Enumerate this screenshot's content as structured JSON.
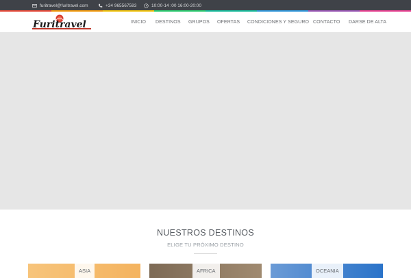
{
  "topbar": {
    "email": "furitravel@furitravel.com",
    "phone": "+34 965567583",
    "hours": "10:00-14 :00 16:00-20:00",
    "icons": {
      "email": "envelope-icon",
      "phone": "phone-icon",
      "hours": "clock-icon"
    }
  },
  "rainbow_colors": [
    "#e74c3c",
    "#f39c12",
    "#f1c40f",
    "#2ecc71",
    "#1abc9c",
    "#3498db",
    "#9b59b6",
    "#e84393"
  ],
  "header": {
    "logo_text": "Furitravel",
    "nav": [
      "INICIO",
      "DESTINOS",
      "GRUPOS",
      "OFERTAS",
      "CONDICIONES Y SEGURO",
      "CONTACTO",
      "DARSE DE ALTA"
    ]
  },
  "destinations": {
    "title": "NUESTROS DESTINOS",
    "subtitle": "ELIGE TU PRÓXIMO DESTINO",
    "cards": [
      {
        "label": "ASIA",
        "color_a": "#f7c47b",
        "color_b": "#f4b35f"
      },
      {
        "label": "AFRICA",
        "color_a": "#7d6a55",
        "color_b": "#a08a70"
      },
      {
        "label": "OCEANIA",
        "color_a": "#6b9bd6",
        "color_b": "#2a73c9"
      }
    ]
  },
  "colors": {
    "topbar": "#3f4248",
    "slider": "#e6e6e6",
    "accent_logo": "#c0392b"
  }
}
